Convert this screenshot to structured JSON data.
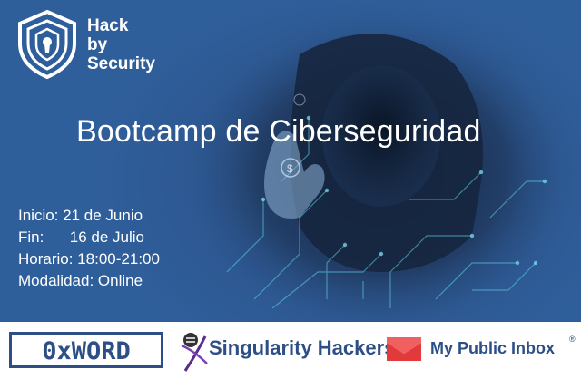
{
  "logo": {
    "line1": "Hack",
    "line2": "by",
    "line3": "Security"
  },
  "title": "Bootcamp de Ciberseguridad",
  "details": [
    {
      "label": "Inicio:",
      "value": "21 de Junio"
    },
    {
      "label": "Fin:",
      "value": "16 de Julio"
    },
    {
      "label": "Horario:",
      "value": "18:00-21:00"
    },
    {
      "label": "Modalidad:",
      "value": "Online"
    }
  ],
  "sponsors": {
    "oxword": "0xWORD",
    "singularity": "Singularity Hackers",
    "mypublicinbox": "My Public Inbox",
    "registered": "®"
  },
  "colors": {
    "background": "#2f5f9b",
    "brand_dark": "#2d4f86",
    "accent_red": "#e23a3a"
  }
}
